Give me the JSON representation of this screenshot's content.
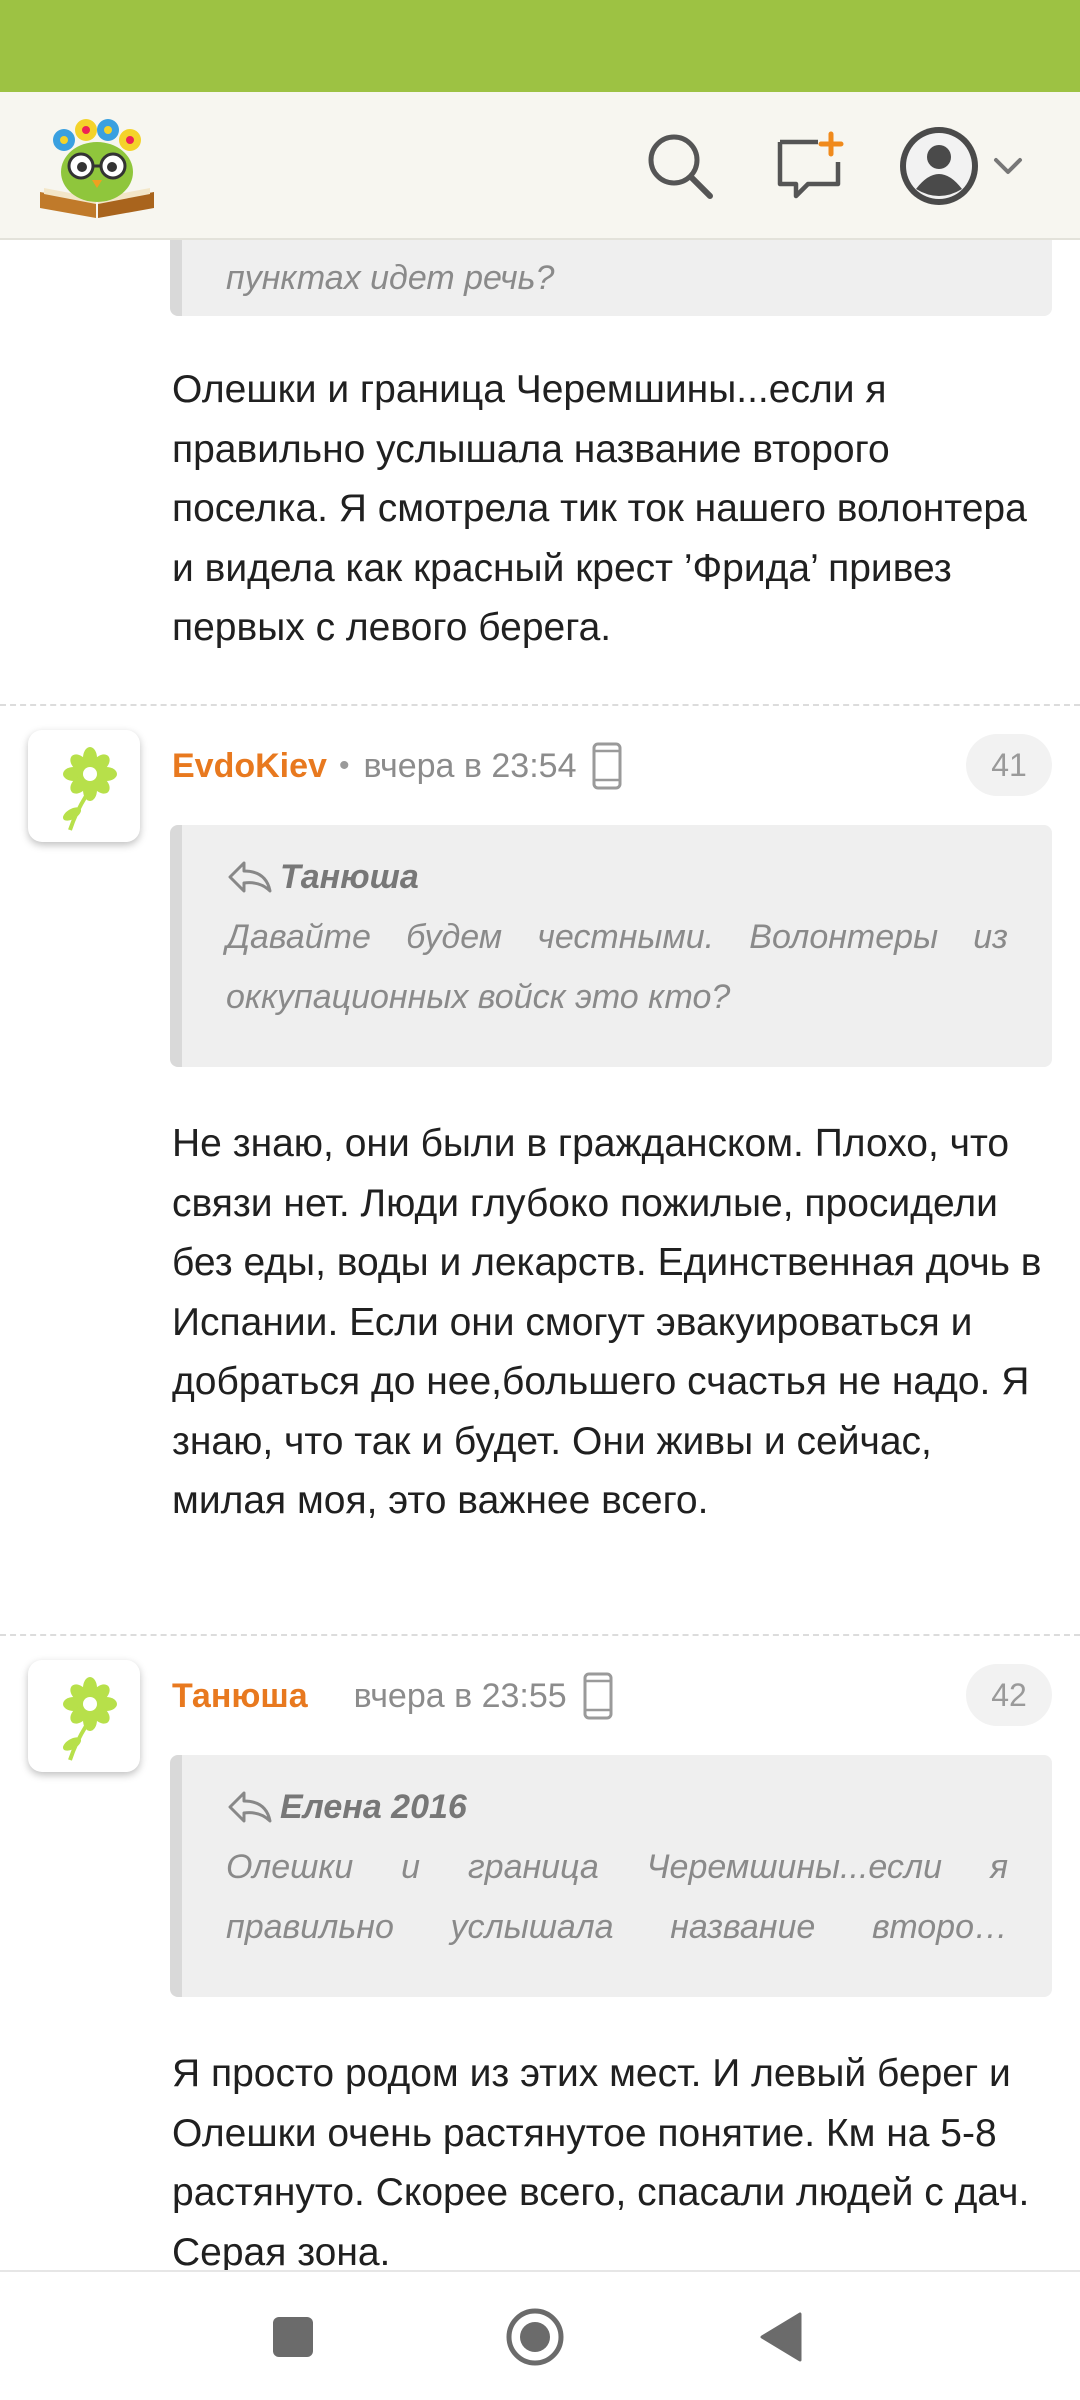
{
  "colors": {
    "status_bar": "#9dc243",
    "author": "#e8791f",
    "quote_bg": "#efefef"
  },
  "header": {
    "logo_icon": "book-owl-logo",
    "search_icon": "search-icon",
    "compose_icon": "new-message-icon",
    "profile_icon": "user-avatar-icon"
  },
  "top_fragment": {
    "quote_text": "пунктах идет речь?",
    "body": "Олешки и граница Черемшины...если я правильно услышала название второго поселка. Я смотрела тик ток нашего волонтера и видела как красный крест ’Фрида’ привез первых с левого берега."
  },
  "comments": [
    {
      "author": "EvdoKiev",
      "separator": "•",
      "time": "вчера в 23:54",
      "number": "41",
      "quote_author": "Танюша",
      "quote_line1": "Давайте будем честными. Волонтеры из",
      "quote_line2": "оккупационных войск это кто?",
      "body": "Не знаю, они были в гражданском. Плохо, что связи нет. Люди глубоко пожилые, просидели без еды, воды и лекарств. Единственная дочь в Испании. Если они смогут эвакуироваться и добраться до нее,большего счастья не надо. Я знаю, что так и будет. Они живы и сейчас, милая моя, это важнее всего."
    },
    {
      "author": "Танюша",
      "time": "вчера в 23:55",
      "number": "42",
      "quote_author": "Елена 2016",
      "quote_line1": "Олешки и граница Черемшины...если я",
      "quote_line2": "правильно услышала название второ…",
      "body": "Я просто родом из этих мест. И левый берег и Олешки очень растянутое понятие. Км на 5-8 растянуто. Скорее всего, спасали людей с дач. Серая зона."
    }
  ],
  "nav": {
    "recents_icon": "recents-square-icon",
    "home_icon": "home-circle-icon",
    "back_icon": "back-triangle-icon"
  }
}
